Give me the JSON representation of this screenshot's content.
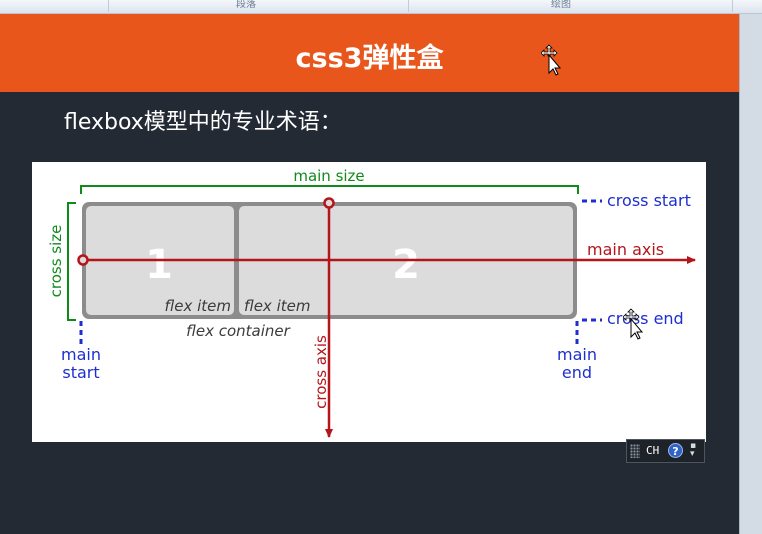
{
  "ribbon": {
    "groups": [
      {
        "label": "段落"
      },
      {
        "label": "绘图"
      }
    ]
  },
  "slide": {
    "title": "css3弹性盒",
    "subtitle": "flexbox模型中的专业术语：",
    "colors": {
      "title_bar": "#e8561c",
      "background": "#232a33",
      "green": "#118a1c",
      "red": "#b3151b",
      "blue": "#1d2fcf",
      "box_gray": "#8c8c8c",
      "item_fill": "#dcdcdc"
    }
  },
  "diagram": {
    "items": [
      {
        "number": "1",
        "label": "flex item"
      },
      {
        "number": "2",
        "label": "flex item"
      }
    ],
    "container_label": "flex container",
    "main_size": "main size",
    "cross_size": "cross size",
    "main_axis": "main axis",
    "cross_axis": "cross axis",
    "cross_start": "cross start",
    "cross_end": "cross end",
    "main_start": [
      "main",
      "start"
    ],
    "main_end": [
      "main",
      "end"
    ]
  },
  "ime": {
    "lang": "CH",
    "help": "?",
    "icon": "help-icon"
  }
}
